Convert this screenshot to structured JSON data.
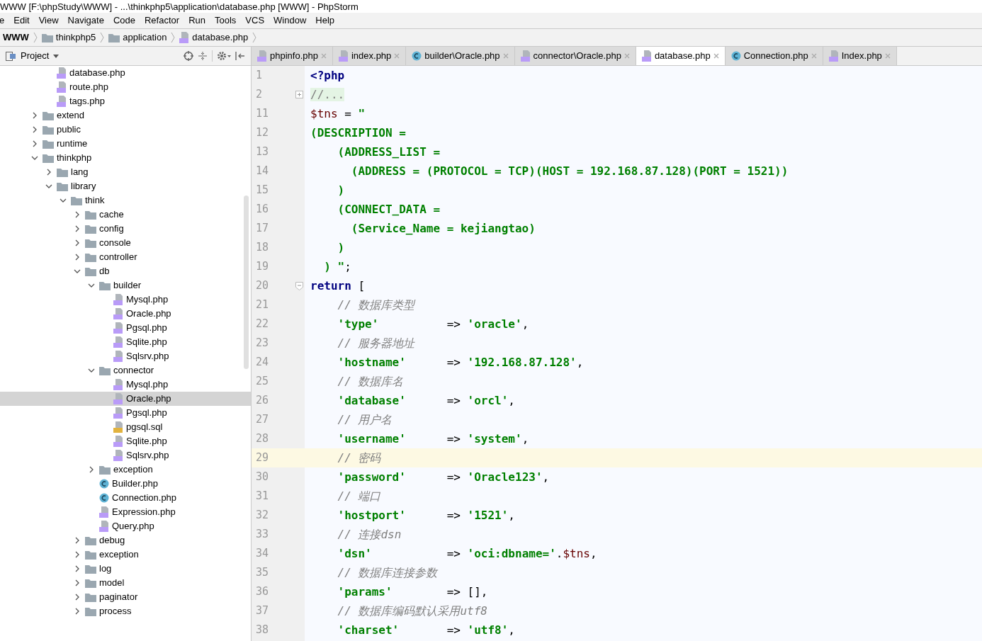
{
  "window": {
    "title": "WWW [F:\\phpStudy\\WWW] - ...\\thinkphp5\\application\\database.php [WWW] - PhpStorm"
  },
  "menu": [
    "e",
    "Edit",
    "View",
    "Navigate",
    "Code",
    "Refactor",
    "Run",
    "Tools",
    "VCS",
    "Window",
    "Help"
  ],
  "breadcrumbs": [
    {
      "label": "WWW",
      "kind": "root"
    },
    {
      "label": "thinkphp5",
      "kind": "folder"
    },
    {
      "label": "application",
      "kind": "folder"
    },
    {
      "label": "database.php",
      "kind": "php"
    }
  ],
  "project_panel": {
    "title": "Project",
    "continued_items": [
      {
        "label": "database.php",
        "kind": "php",
        "selected": false
      },
      {
        "label": "route.php",
        "kind": "php",
        "selected": false
      },
      {
        "label": "tags.php",
        "kind": "php",
        "selected": false
      }
    ],
    "items": [
      {
        "label": "extend",
        "kind": "folder",
        "expanded": false,
        "selected": false
      },
      {
        "label": "public",
        "kind": "folder",
        "expanded": false,
        "selected": false
      },
      {
        "label": "runtime",
        "kind": "folder",
        "expanded": false,
        "selected": false
      },
      {
        "label": "thinkphp",
        "kind": "folder",
        "expanded": true,
        "selected": false,
        "children": [
          {
            "label": "lang",
            "kind": "folder",
            "expanded": false,
            "selected": false
          },
          {
            "label": "library",
            "kind": "folder",
            "expanded": true,
            "selected": false,
            "children": [
              {
                "label": "think",
                "kind": "folder",
                "expanded": true,
                "selected": false,
                "children": [
                  {
                    "label": "cache",
                    "kind": "folder",
                    "expanded": false,
                    "selected": false
                  },
                  {
                    "label": "config",
                    "kind": "folder",
                    "expanded": false,
                    "selected": false
                  },
                  {
                    "label": "console",
                    "kind": "folder",
                    "expanded": false,
                    "selected": false
                  },
                  {
                    "label": "controller",
                    "kind": "folder",
                    "expanded": false,
                    "selected": false
                  },
                  {
                    "label": "db",
                    "kind": "folder",
                    "expanded": true,
                    "selected": false,
                    "children": [
                      {
                        "label": "builder",
                        "kind": "folder",
                        "expanded": true,
                        "selected": false,
                        "children": [
                          {
                            "label": "Mysql.php",
                            "kind": "php",
                            "selected": false
                          },
                          {
                            "label": "Oracle.php",
                            "kind": "php",
                            "selected": false
                          },
                          {
                            "label": "Pgsql.php",
                            "kind": "php",
                            "selected": false
                          },
                          {
                            "label": "Sqlite.php",
                            "kind": "php",
                            "selected": false
                          },
                          {
                            "label": "Sqlsrv.php",
                            "kind": "php",
                            "selected": false
                          }
                        ]
                      },
                      {
                        "label": "connector",
                        "kind": "folder",
                        "expanded": true,
                        "selected": false,
                        "children": [
                          {
                            "label": "Mysql.php",
                            "kind": "php",
                            "selected": false
                          },
                          {
                            "label": "Oracle.php",
                            "kind": "php",
                            "selected": true
                          },
                          {
                            "label": "Pgsql.php",
                            "kind": "php",
                            "selected": false
                          },
                          {
                            "label": "pgsql.sql",
                            "kind": "sql",
                            "selected": false
                          },
                          {
                            "label": "Sqlite.php",
                            "kind": "php",
                            "selected": false
                          },
                          {
                            "label": "Sqlsrv.php",
                            "kind": "php",
                            "selected": false
                          }
                        ]
                      },
                      {
                        "label": "exception",
                        "kind": "folder",
                        "expanded": false,
                        "selected": false
                      },
                      {
                        "label": "Builder.php",
                        "kind": "class",
                        "selected": false
                      },
                      {
                        "label": "Connection.php",
                        "kind": "class",
                        "selected": false
                      },
                      {
                        "label": "Expression.php",
                        "kind": "php",
                        "selected": false
                      },
                      {
                        "label": "Query.php",
                        "kind": "php",
                        "selected": false
                      }
                    ]
                  },
                  {
                    "label": "debug",
                    "kind": "folder",
                    "expanded": false,
                    "selected": false
                  },
                  {
                    "label": "exception",
                    "kind": "folder",
                    "expanded": false,
                    "selected": false
                  },
                  {
                    "label": "log",
                    "kind": "folder",
                    "expanded": false,
                    "selected": false
                  },
                  {
                    "label": "model",
                    "kind": "folder",
                    "expanded": false,
                    "selected": false
                  },
                  {
                    "label": "paginator",
                    "kind": "folder",
                    "expanded": false,
                    "selected": false
                  },
                  {
                    "label": "process",
                    "kind": "folder",
                    "expanded": false,
                    "selected": false
                  }
                ]
              }
            ]
          }
        ]
      }
    ]
  },
  "tabs": [
    {
      "label": "phpinfo.php",
      "kind": "php",
      "selected": false
    },
    {
      "label": "index.php",
      "kind": "php",
      "selected": false
    },
    {
      "label": "builder\\Oracle.php",
      "kind": "class",
      "selected": false
    },
    {
      "label": "connector\\Oracle.php",
      "kind": "php",
      "selected": false
    },
    {
      "label": "database.php",
      "kind": "php",
      "selected": true
    },
    {
      "label": "Connection.php",
      "kind": "class",
      "selected": false
    },
    {
      "label": "Index.php",
      "kind": "php",
      "selected": false
    }
  ],
  "editor": {
    "lines": [
      {
        "number": "1",
        "current": false,
        "tokens": [
          {
            "kind": "tag",
            "text": "<?php"
          }
        ]
      },
      {
        "number": "2",
        "current": false,
        "foldable": true,
        "folded": true,
        "tokens": [
          {
            "kind": "folded",
            "text": "//..."
          }
        ]
      },
      {
        "number": "11",
        "current": false,
        "tokens": [
          {
            "kind": "var",
            "text": "$tns"
          },
          {
            "kind": "plain",
            "text": " = "
          },
          {
            "kind": "string",
            "text": "\""
          }
        ]
      },
      {
        "number": "12",
        "current": false,
        "tokens": [
          {
            "kind": "string",
            "text": "(DESCRIPTION ="
          }
        ]
      },
      {
        "number": "13",
        "current": false,
        "tokens": [
          {
            "kind": "string",
            "text": "    (ADDRESS_LIST ="
          }
        ]
      },
      {
        "number": "14",
        "current": false,
        "tokens": [
          {
            "kind": "string",
            "text": "      (ADDRESS = (PROTOCOL = TCP)(HOST = 192.168.87.128)(PORT = 1521))"
          }
        ]
      },
      {
        "number": "15",
        "current": false,
        "tokens": [
          {
            "kind": "string",
            "text": "    )"
          }
        ]
      },
      {
        "number": "16",
        "current": false,
        "tokens": [
          {
            "kind": "string",
            "text": "    (CONNECT_DATA ="
          }
        ]
      },
      {
        "number": "17",
        "current": false,
        "tokens": [
          {
            "kind": "string",
            "text": "      (Service_Name = kejiangtao)"
          }
        ]
      },
      {
        "number": "18",
        "current": false,
        "tokens": [
          {
            "kind": "string",
            "text": "    )"
          }
        ]
      },
      {
        "number": "19",
        "current": false,
        "tokens": [
          {
            "kind": "string",
            "text": "  ) \""
          },
          {
            "kind": "plain",
            "text": ";"
          }
        ]
      },
      {
        "number": "20",
        "current": false,
        "foldable": true,
        "folded": false,
        "tokens": [
          {
            "kind": "keyword",
            "text": "return"
          },
          {
            "kind": "plain",
            "text": " ["
          }
        ]
      },
      {
        "number": "21",
        "current": false,
        "tokens": [
          {
            "kind": "comment",
            "text": "    // 数据库类型"
          }
        ]
      },
      {
        "number": "22",
        "current": false,
        "tokens": [
          {
            "kind": "string",
            "text": "    'type'"
          },
          {
            "kind": "plain",
            "text": "          => "
          },
          {
            "kind": "string",
            "text": "'oracle'"
          },
          {
            "kind": "plain",
            "text": ","
          }
        ]
      },
      {
        "number": "23",
        "current": false,
        "tokens": [
          {
            "kind": "comment",
            "text": "    // 服务器地址"
          }
        ]
      },
      {
        "number": "24",
        "current": false,
        "tokens": [
          {
            "kind": "string",
            "text": "    'hostname'"
          },
          {
            "kind": "plain",
            "text": "      => "
          },
          {
            "kind": "string",
            "text": "'192.168.87.128'"
          },
          {
            "kind": "plain",
            "text": ","
          }
        ]
      },
      {
        "number": "25",
        "current": false,
        "tokens": [
          {
            "kind": "comment",
            "text": "    // 数据库名"
          }
        ]
      },
      {
        "number": "26",
        "current": false,
        "tokens": [
          {
            "kind": "string",
            "text": "    'database'"
          },
          {
            "kind": "plain",
            "text": "      => "
          },
          {
            "kind": "string",
            "text": "'orcl'"
          },
          {
            "kind": "plain",
            "text": ","
          }
        ]
      },
      {
        "number": "27",
        "current": false,
        "tokens": [
          {
            "kind": "comment",
            "text": "    // 用户名"
          }
        ]
      },
      {
        "number": "28",
        "current": false,
        "tokens": [
          {
            "kind": "string",
            "text": "    'username'"
          },
          {
            "kind": "plain",
            "text": "      => "
          },
          {
            "kind": "string",
            "text": "'system'"
          },
          {
            "kind": "plain",
            "text": ","
          }
        ]
      },
      {
        "number": "29",
        "current": true,
        "tokens": [
          {
            "kind": "comment",
            "text": "    // 密码"
          }
        ]
      },
      {
        "number": "30",
        "current": false,
        "tokens": [
          {
            "kind": "string",
            "text": "    'password'"
          },
          {
            "kind": "plain",
            "text": "      => "
          },
          {
            "kind": "string",
            "text": "'Oracle123'"
          },
          {
            "kind": "plain",
            "text": ","
          }
        ]
      },
      {
        "number": "31",
        "current": false,
        "tokens": [
          {
            "kind": "comment",
            "text": "    // 端口"
          }
        ]
      },
      {
        "number": "32",
        "current": false,
        "tokens": [
          {
            "kind": "string",
            "text": "    'hostport'"
          },
          {
            "kind": "plain",
            "text": "      => "
          },
          {
            "kind": "string",
            "text": "'1521'"
          },
          {
            "kind": "plain",
            "text": ","
          }
        ]
      },
      {
        "number": "33",
        "current": false,
        "tokens": [
          {
            "kind": "comment",
            "text": "    // 连接dsn"
          }
        ]
      },
      {
        "number": "34",
        "current": false,
        "tokens": [
          {
            "kind": "string",
            "text": "    'dsn'"
          },
          {
            "kind": "plain",
            "text": "           => "
          },
          {
            "kind": "string",
            "text": "'oci:dbname='"
          },
          {
            "kind": "plain",
            "text": "."
          },
          {
            "kind": "var",
            "text": "$tns"
          },
          {
            "kind": "plain",
            "text": ","
          }
        ]
      },
      {
        "number": "35",
        "current": false,
        "tokens": [
          {
            "kind": "comment",
            "text": "    // 数据库连接参数"
          }
        ]
      },
      {
        "number": "36",
        "current": false,
        "tokens": [
          {
            "kind": "string",
            "text": "    'params'"
          },
          {
            "kind": "plain",
            "text": "        => [],"
          }
        ]
      },
      {
        "number": "37",
        "current": false,
        "tokens": [
          {
            "kind": "comment",
            "text": "    // 数据库编码默认采用utf8"
          }
        ]
      },
      {
        "number": "38",
        "current": false,
        "tokens": [
          {
            "kind": "string",
            "text": "    'charset'"
          },
          {
            "kind": "plain",
            "text": "       => "
          },
          {
            "kind": "string",
            "text": "'utf8'"
          },
          {
            "kind": "plain",
            "text": ","
          }
        ]
      }
    ]
  }
}
